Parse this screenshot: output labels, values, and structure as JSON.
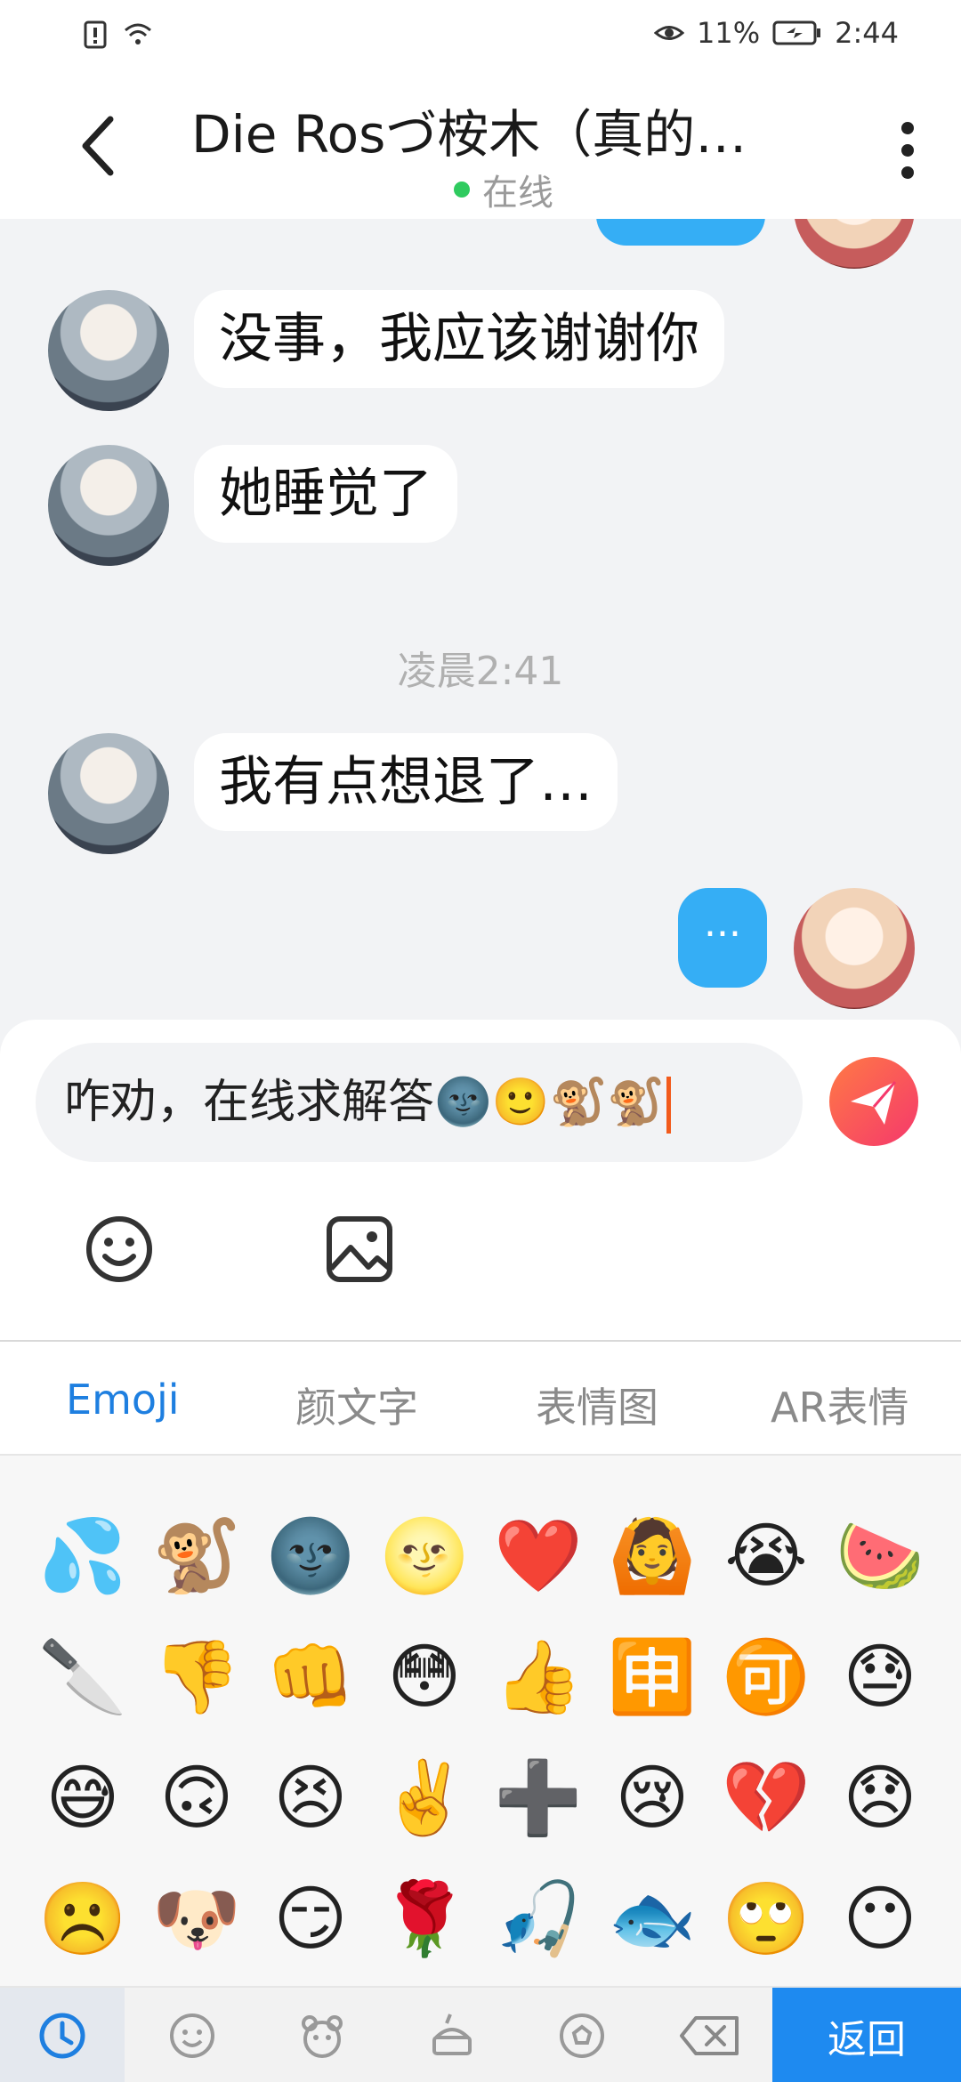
{
  "status_bar": {
    "battery": "11%",
    "time": "2:44"
  },
  "header": {
    "title": "Die Rosづ桉木（真的…",
    "status": "在线"
  },
  "chat": {
    "messages": [
      {
        "text": "没事，我应该谢谢你"
      },
      {
        "text": "她睡觉了"
      },
      {
        "text": "我有点想退了…"
      }
    ],
    "timestamp": "凌晨2:41",
    "typing_indicator": "..."
  },
  "composer": {
    "value_text": "咋劝，在线求解答",
    "value_emojis": "🌚🙂🐒🐒"
  },
  "emoji_tabs": [
    {
      "label": "Emoji"
    },
    {
      "label": "颜文字"
    },
    {
      "label": "表情图"
    },
    {
      "label": "AR表情"
    }
  ],
  "emoji_grid": [
    "💦",
    "🐒",
    "🌚",
    "🌝",
    "❤️",
    "🙆",
    "😭",
    "🍉",
    "🔪",
    "👎",
    "👊",
    "😳",
    "👍",
    "🈸",
    "🉑",
    "😓",
    "😅",
    "🙃",
    "😣",
    "✌️",
    "➕",
    "😢",
    "💔",
    "😞",
    "☹️",
    "🐶",
    "😏",
    "🌹",
    "🎣",
    "🐟",
    "🙄",
    "😶"
  ],
  "bottom_bar": {
    "return_label": "返回"
  },
  "colors": {
    "accent_blue": "#1e8af0",
    "bubble_blue": "#35aef5",
    "online_green": "#2fcb5f",
    "send_gradient_start": "#ff7a45",
    "send_gradient_end": "#f5386c"
  }
}
